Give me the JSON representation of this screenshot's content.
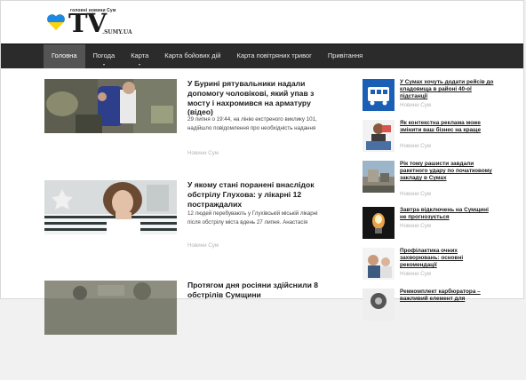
{
  "header": {
    "tagline": "головні новини Сум",
    "logo_main": "TV",
    "logo_domain": ".SUMY.UA"
  },
  "nav": {
    "items": [
      {
        "label": "Головна",
        "active": true,
        "dropdown": false
      },
      {
        "label": "Погода",
        "active": false,
        "dropdown": true
      },
      {
        "label": "Карта",
        "active": false,
        "dropdown": true
      },
      {
        "label": "Карта бойових дій",
        "active": false,
        "dropdown": false
      },
      {
        "label": "Карта повітряних тривог",
        "active": false,
        "dropdown": false
      },
      {
        "label": "Привітання",
        "active": false,
        "dropdown": false
      }
    ]
  },
  "articles": [
    {
      "title": "У Бурині рятувальники надали допомогу чоловікові, який упав з мосту і нахромився на арматуру (відео)",
      "excerpt": "29 липня о 19:44, на лінію екстреного виклику 101, надійшло повідомлення про необхідність надання",
      "category": "Новини Сум"
    },
    {
      "title": "У якому стані поранені внаслідок обстрілу Глухова: у лікарні 12 постраждалих",
      "excerpt": "12 людей перебувають у Глухівській міській лікарні після обстрілу міста вдень 27 липня. Анастасія",
      "category": "Новини Сум"
    },
    {
      "title": "Протягом дня росіяни здійснили 8 обстрілів Сумщини",
      "excerpt": "",
      "category": ""
    }
  ],
  "sidebar": {
    "items": [
      {
        "title": "У Сумах хочуть додати рейсів до кладовища в районі 40-ої підстанції",
        "category": "Новини Сум"
      },
      {
        "title": "Як контекстна реклама може змінити ваш бізнес на краще",
        "category": "Новини Сум"
      },
      {
        "title": "Рік тому рашисти завдали ракетного удару по початковому закладу в Сумах",
        "category": "Новини Сум"
      },
      {
        "title": "Завтра відключень на Сумщині не прогнозується",
        "category": "Новини Сум"
      },
      {
        "title": "Профілактика очних захворювань: основні рекомендації",
        "category": "Новини Сум"
      },
      {
        "title": "Ремкомплект карбюратора – важливий елемент для",
        "category": ""
      }
    ]
  },
  "colors": {
    "nav_bg": "#2b2b2b",
    "nav_active": "#545454",
    "category_text": "#b5b5b5",
    "logo_blue": "#1e88e5",
    "logo_yellow": "#ffd20a"
  }
}
